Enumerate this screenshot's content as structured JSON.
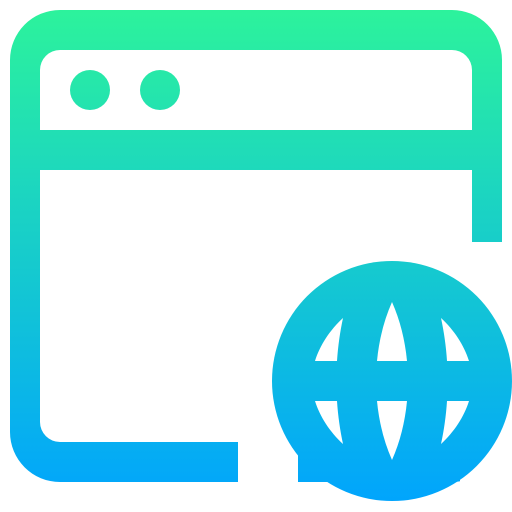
{
  "icon": {
    "name": "browser-globe-icon",
    "gradient": {
      "top": "#2df49a",
      "bottom": "#00a3ff"
    },
    "background": "#ffffff"
  }
}
